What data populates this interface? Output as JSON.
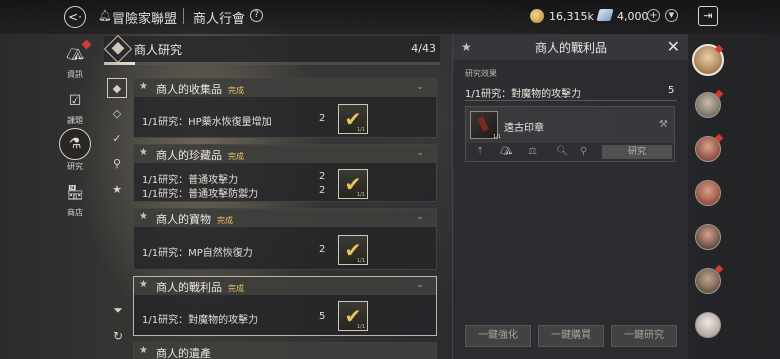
{
  "header": {
    "crumb1": "冒險家聯盟",
    "crumb2": "商人行會",
    "help": "?",
    "gold": "16,315k",
    "gems": "4,000",
    "plus": "+",
    "dropdown": "▼"
  },
  "nav": [
    {
      "label": "資訊"
    },
    {
      "label": "課題"
    },
    {
      "label": "研究"
    },
    {
      "label": "商店"
    }
  ],
  "research": {
    "title": "商人研究",
    "count": "4/43",
    "progress": 0.093
  },
  "cards": [
    {
      "title": "商人的收集品",
      "status": "完成",
      "rows": [
        {
          "text": "1/1研究：HP藥水恢復量增加",
          "value": "2"
        }
      ],
      "reward_count": "1/1"
    },
    {
      "title": "商人的珍藏品",
      "status": "完成",
      "rows": [
        {
          "text": "1/1研究：普通攻擊力",
          "value": "2"
        },
        {
          "text": "1/1研究：普通攻擊防禦力",
          "value": "2"
        }
      ],
      "reward_count": "1/1"
    },
    {
      "title": "商人的寶物",
      "status": "完成",
      "rows": [
        {
          "text": "1/1研究：MP自然恢復力",
          "value": "2"
        }
      ],
      "reward_count": "1/1"
    },
    {
      "title": "商人的戰利品",
      "status": "完成",
      "rows": [
        {
          "text": "1/1研究：對魔物的攻擊力",
          "value": "5"
        }
      ],
      "reward_count": "1/1"
    },
    {
      "title": "商人的遺產",
      "status": "",
      "rows": [],
      "reward_count": ""
    }
  ],
  "detail": {
    "title": "商人的戰利品",
    "close": "✕",
    "section_label": "研究效果",
    "effect_text": "1/1研究：對魔物的攻擊力",
    "effect_value": "5",
    "item_name": "遠古印章",
    "item_qty": "1/1",
    "research_button": "研究",
    "bottom_buttons": [
      "一鍵強化",
      "一鍵購買",
      "一鍵研究"
    ]
  },
  "colors": {
    "accent_gold": "#e8c45c",
    "alert_red": "#d03b33",
    "panel_bg": "#2c2d31"
  },
  "icons": {
    "back": "back-arrow-icon",
    "exit": "exit-icon",
    "check": "checkmark-icon",
    "filter": "funnel-icon",
    "refresh": "refresh-icon"
  }
}
